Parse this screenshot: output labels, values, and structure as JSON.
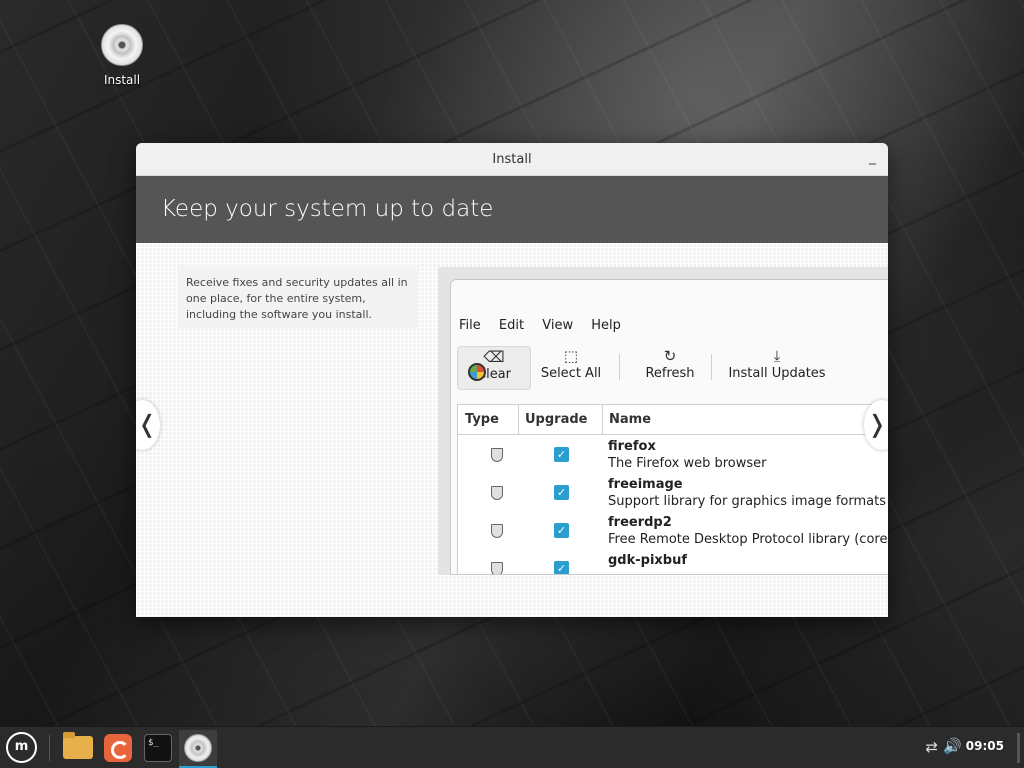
{
  "desktop": {
    "icon_label": "Install"
  },
  "window": {
    "title": "Install",
    "minimize_glyph": "_",
    "banner": "Keep your system up to date",
    "description": "Receive fixes and security updates all in one place, for the entire system, including the software you install.",
    "nav_prev": "❬",
    "nav_next": "❭"
  },
  "update_manager": {
    "menu": [
      "File",
      "Edit",
      "View",
      "Help"
    ],
    "toolbar": {
      "clear": "Clear",
      "select_all": "Select All",
      "refresh": "Refresh",
      "install_updates": "Install Updates"
    },
    "columns": [
      "Type",
      "Upgrade",
      "Name"
    ],
    "rows": [
      {
        "name": "firefox",
        "description": "The Firefox web browser",
        "checked": true
      },
      {
        "name": "freeimage",
        "description": "Support library for graphics image formats (libr",
        "checked": true
      },
      {
        "name": "freerdp2",
        "description": "Free Remote Desktop Protocol library (core libr",
        "checked": true
      },
      {
        "name": "gdk-pixbuf",
        "description": "",
        "checked": true
      }
    ]
  },
  "taskbar": {
    "menu_logo": "m",
    "terminal_glyph": "$_",
    "clock": "09:05",
    "accent_color": "#2a9fcf"
  }
}
